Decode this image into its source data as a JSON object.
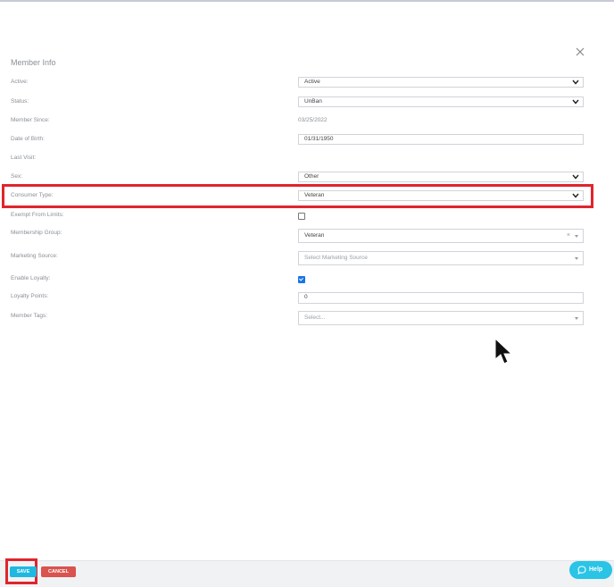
{
  "dialog": {
    "title": "Member Info"
  },
  "fields": {
    "active": {
      "label": "Active:",
      "value": "Active"
    },
    "status": {
      "label": "Status:",
      "value": "UnBan"
    },
    "member_since": {
      "label": "Member Since:",
      "value": "03/25/2022"
    },
    "date_of_birth": {
      "label": "Date of Birth:",
      "value": "01/31/1950"
    },
    "last_visit": {
      "label": "Last Visit:",
      "value": ""
    },
    "sex": {
      "label": "Sex:",
      "value": "Other"
    },
    "consumer_type": {
      "label": "Consumer Type:",
      "value": "Veteran"
    },
    "exempt_from_limits": {
      "label": "Exempt From Limits:",
      "checked": false
    },
    "membership_group": {
      "label": "Membership Group:",
      "value": "Veteran",
      "clear": "×"
    },
    "marketing_source": {
      "label": "Marketing Source:",
      "placeholder": "Select Marketing Source"
    },
    "enable_loyalty": {
      "label": "Enable Loyalty:",
      "checked": true
    },
    "loyalty_points": {
      "label": "Loyalty Points:",
      "value": "0"
    },
    "member_tags": {
      "label": "Member Tags:",
      "placeholder": "Select..."
    }
  },
  "footer": {
    "save_label": "SAVE",
    "cancel_label": "CANCEL"
  },
  "help": {
    "label": "Help"
  },
  "colors": {
    "highlight": "#e0242d",
    "save": "#20b8e0",
    "cancel": "#d9534f",
    "help": "#29c4e6"
  },
  "icons": {
    "close": "close-icon",
    "chevron": "chevron-down-icon",
    "help": "chat-bubble-icon",
    "cursor": "mouse-pointer-icon"
  }
}
